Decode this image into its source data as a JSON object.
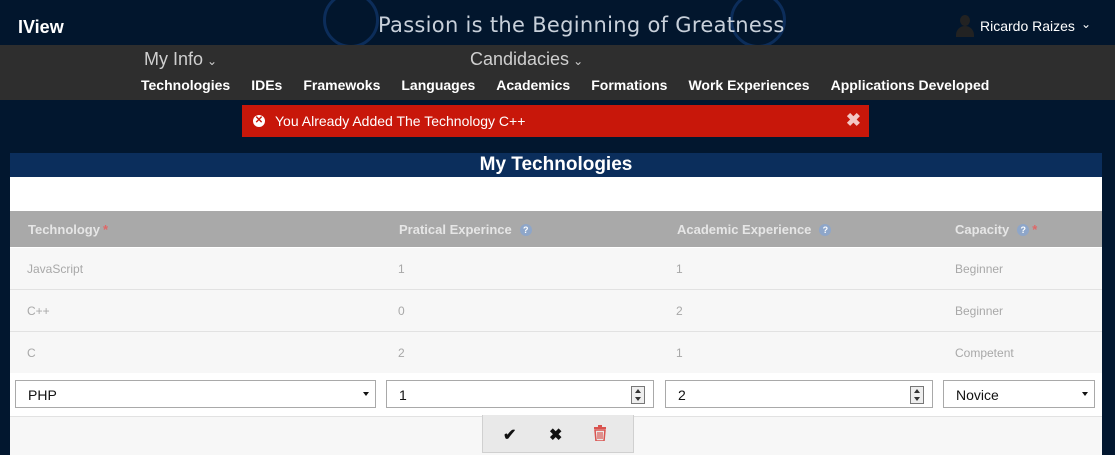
{
  "header": {
    "brand": "IView",
    "slogan": "Passion is the Beginning of Greatness",
    "user_name": "Ricardo Raizes",
    "user_chevron": "⌄"
  },
  "nav": {
    "top_menus": [
      {
        "label": "My Info",
        "chevron": "⌄"
      },
      {
        "label": "Candidacies",
        "chevron": "⌄"
      }
    ],
    "sub_items": [
      "Technologies",
      "IDEs",
      "Framewoks",
      "Languages",
      "Academics",
      "Formations",
      "Work Experiences",
      "Applications Developed"
    ]
  },
  "alert": {
    "message": "You Already Added The Technology C++",
    "icon": "x-circle-icon",
    "close_symbol": "✖",
    "color": "#c8170a"
  },
  "panel": {
    "title": "My Technologies",
    "columns": [
      {
        "label": "Technology",
        "required": true,
        "help": false
      },
      {
        "label": "Pratical Experince",
        "required": false,
        "help": true
      },
      {
        "label": "Academic Experience",
        "required": false,
        "help": true
      },
      {
        "label": "Capacity",
        "required": true,
        "help": true
      }
    ],
    "required_mark": "*",
    "help_mark": "?",
    "rows": [
      {
        "technology": "JavaScript",
        "practical": "1",
        "academic": "1",
        "capacity": "Beginner"
      },
      {
        "technology": "C++",
        "practical": "0",
        "academic": "2",
        "capacity": "Beginner"
      },
      {
        "technology": "C",
        "practical": "2",
        "academic": "1",
        "capacity": "Competent"
      }
    ],
    "edit_row": {
      "technology": "PHP",
      "practical": "1",
      "academic": "2",
      "capacity": "Novice"
    },
    "actions": {
      "confirm_symbol": "✔",
      "cancel_symbol": "✖",
      "delete_symbol": "🗑"
    }
  },
  "colors": {
    "page_bg": "#02172f",
    "nav_bg": "#2e2e2e",
    "panel_title_bg": "#0b2e5c",
    "alert_bg": "#c8170a",
    "delete_icon": "#d9534f"
  }
}
